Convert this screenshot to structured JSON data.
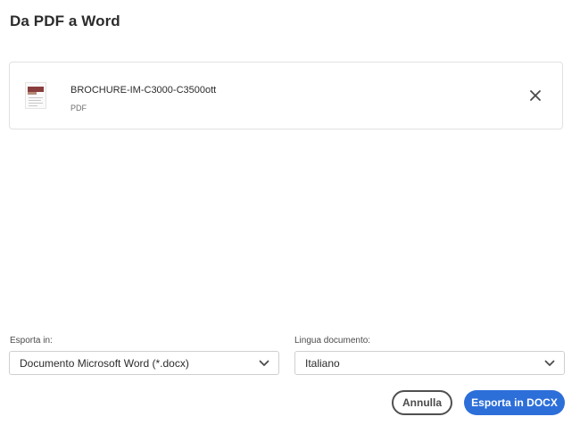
{
  "dialog": {
    "title": "Da PDF a Word"
  },
  "file": {
    "name": "BROCHURE-IM-C3000-C3500ott",
    "type": "PDF",
    "thumbnail_icon": "pdf-thumbnail",
    "remove_icon": "close-icon"
  },
  "export_to": {
    "label": "Esporta in:",
    "value": "Documento Microsoft Word (*.docx)"
  },
  "document_language": {
    "label": "Lingua documento:",
    "value": "Italiano"
  },
  "actions": {
    "cancel_label": "Annulla",
    "export_label": "Esporta in DOCX"
  },
  "colors": {
    "primary": "#2d6fd9",
    "text": "#2c2c2c",
    "border": "#cfcfcf"
  }
}
